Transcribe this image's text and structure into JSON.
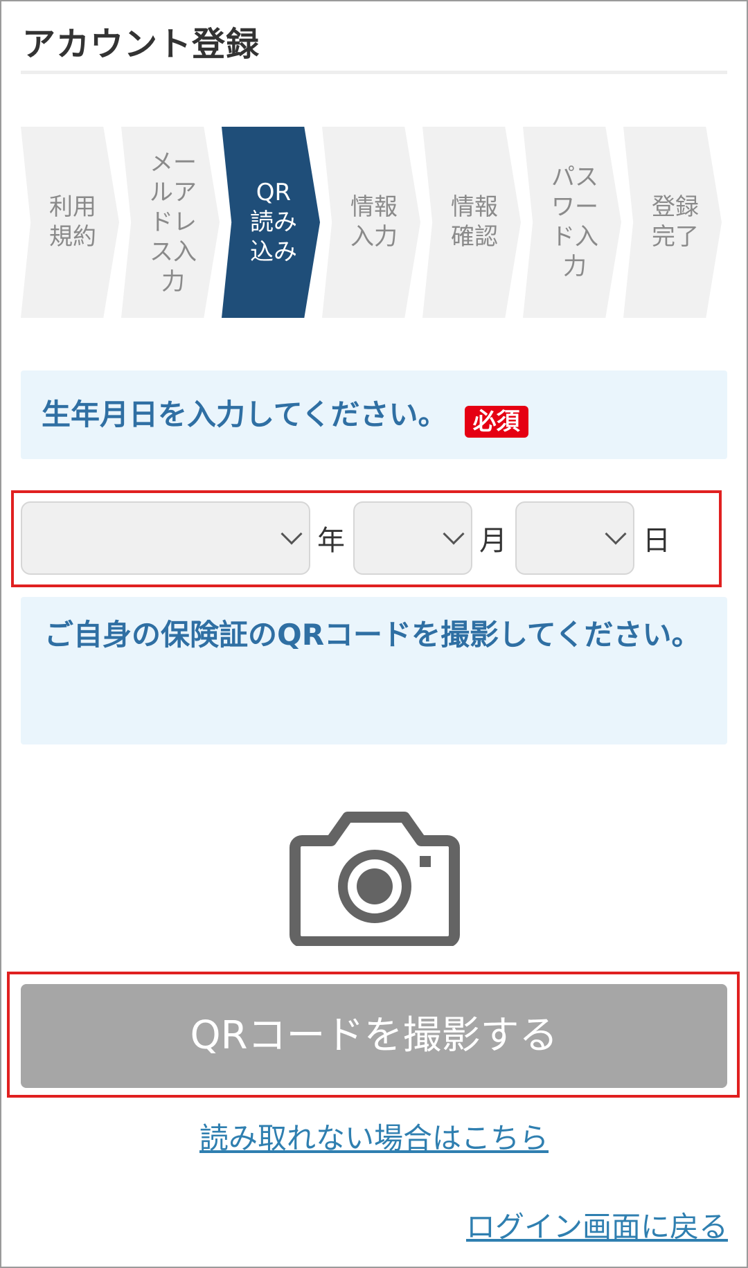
{
  "header": {
    "title": "アカウント登録"
  },
  "steps": [
    {
      "label": "利用規約",
      "active": false
    },
    {
      "label": "メールアドレス入力",
      "active": false
    },
    {
      "label": "QR読み込み",
      "active": true
    },
    {
      "label": "情報入力",
      "active": false
    },
    {
      "label": "情報確認",
      "active": false
    },
    {
      "label": "パスワード入力",
      "active": false
    },
    {
      "label": "登録完了",
      "active": false
    }
  ],
  "birthdate": {
    "prompt": "生年月日を入力してください。",
    "required_badge": "必須",
    "year_unit": "年",
    "month_unit": "月",
    "day_unit": "日",
    "year_value": "",
    "month_value": "",
    "day_value": ""
  },
  "qr": {
    "instruction": "ご自身の保険証のQRコードを撮影してください。",
    "camera_icon": "camera-icon",
    "button_label": "QRコードを撮影する",
    "unreadable_link": "読み取れない場合はこちら"
  },
  "footer": {
    "back_to_login": "ログイン画面に戻る"
  },
  "colors": {
    "active_step": "#1f4e79",
    "inactive_step": "#f1f1f1",
    "notice_bg": "#eaf5fc",
    "notice_text": "#2f6fa3",
    "required_badge": "#e50012",
    "highlight_border": "#e02020",
    "button_disabled": "#a6a6a6",
    "link": "#2f7fb0"
  }
}
